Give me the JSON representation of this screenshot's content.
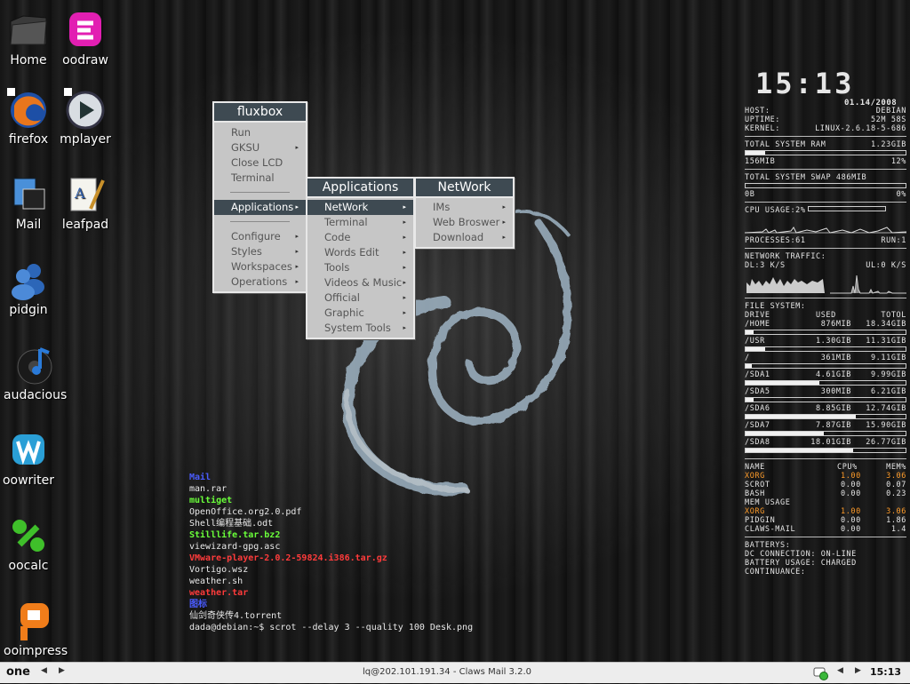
{
  "desktop_icons": [
    {
      "label": "Home",
      "icon": "folder-icon"
    },
    {
      "label": "oodraw",
      "icon": "draw-icon"
    },
    {
      "label": "firefox",
      "icon": "firefox-icon"
    },
    {
      "label": "mplayer",
      "icon": "mplayer-icon"
    },
    {
      "label": "Mail",
      "icon": "mail-icon"
    },
    {
      "label": "leafpad",
      "icon": "leafpad-icon"
    },
    {
      "label": "pidgin",
      "icon": "pidgin-icon"
    },
    {
      "label": "audacious",
      "icon": "audacious-icon"
    },
    {
      "label": "oowriter",
      "icon": "writer-icon"
    },
    {
      "label": "oocalc",
      "icon": "calc-icon"
    },
    {
      "label": "ooimpress",
      "icon": "impress-icon"
    }
  ],
  "root_menu": {
    "title": "fluxbox",
    "items": [
      "Run",
      "GKSU",
      "Close LCD",
      "Terminal",
      "Applications",
      "Configure",
      "Styles",
      "Workspaces",
      "Operations"
    ]
  },
  "apps_menu": {
    "title": "Applications",
    "items": [
      "NetWork",
      "Terminal",
      "Code",
      "Words Edit",
      "Tools",
      "Videos & Music",
      "Official",
      "Graphic",
      "System Tools"
    ]
  },
  "network_menu": {
    "title": "NetWork",
    "items": [
      "IMs",
      "Web Broswer",
      "Download"
    ]
  },
  "terminal": {
    "lines": [
      "Mail",
      "man.rar",
      "multiget",
      "OpenOffice.org2.0.pdf",
      "Shell编程基础.odt",
      "Stilllife.tar.bz2",
      "viewizard-gpg.asc",
      "VMware-player-2.0.2-59824.i386.tar.gz",
      "Vortigo.wsz",
      "weather.sh",
      "weather.tar",
      "图标",
      "仙剑奇侠传4.torrent",
      "dada@debian:~$ scrot --delay 3 --quality 100 Desk.png"
    ]
  },
  "conky": {
    "time": "15:13",
    "date": "01.14/2008",
    "host_label": "HOST:",
    "host": "DEBIAN",
    "uptime_label": "UPTIME:",
    "uptime": "52M 58S",
    "kernel_label": "KERNEL:",
    "kernel": "LINUX-2.6.18-5-686",
    "ram_label": "TOTAL SYSTEM RAM",
    "ram_total": "1.23GIB",
    "ram_used": "156MIB",
    "ram_pct": "12%",
    "ram_fraction": 0.12,
    "swap_label": "TOTAL SYSTEM SWAP 486MIB",
    "swap_used": "0B",
    "swap_pct": "0%",
    "swap_fraction": 0,
    "cpu_label": "CPU USAGE:2%",
    "processes_label": "PROCESSES:61",
    "run_label": "RUN:1",
    "net_label": "NETWORK TRAFFIC:",
    "dl": "DL:3 K/S",
    "ul": "UL:0 K/S",
    "fs_label": "FILE SYSTEM:",
    "fs_headers": [
      "DRIVE",
      "USED",
      "TOTOL"
    ],
    "fs": [
      {
        "drive": "/HOME",
        "used": "876MIB",
        "total": "18.34GIB",
        "fraction": 0.05
      },
      {
        "drive": "/USR",
        "used": "1.30GIB",
        "total": "11.31GIB",
        "fraction": 0.12
      },
      {
        "drive": "/",
        "used": "361MIB",
        "total": "9.11GIB",
        "fraction": 0.04
      },
      {
        "drive": "/SDA1",
        "used": "4.61GIB",
        "total": "9.99GIB",
        "fraction": 0.46
      },
      {
        "drive": "/SDA5",
        "used": "300MIB",
        "total": "6.21GIB",
        "fraction": 0.05
      },
      {
        "drive": "/SDA6",
        "used": "8.85GIB",
        "total": "12.74GIB",
        "fraction": 0.69
      },
      {
        "drive": "/SDA7",
        "used": "7.87GIB",
        "total": "15.90GIB",
        "fraction": 0.49
      },
      {
        "drive": "/SDA8",
        "used": "18.01GIB",
        "total": "26.77GIB",
        "fraction": 0.67
      }
    ],
    "proc_headers": [
      "NAME",
      "CPU%",
      "MEM%"
    ],
    "procs_cpu": [
      {
        "name": "XORG",
        "cpu": "1.00",
        "mem": "3.06",
        "highlight": true
      },
      {
        "name": "SCROT",
        "cpu": "0.00",
        "mem": "0.07",
        "highlight": false
      },
      {
        "name": "BASH",
        "cpu": "0.00",
        "mem": "0.23",
        "highlight": false
      }
    ],
    "mem_usage_label": "MEM USAGE",
    "procs_mem": [
      {
        "name": "XORG",
        "cpu": "1.00",
        "mem": "3.06",
        "highlight": true
      },
      {
        "name": "PIDGIN",
        "cpu": "0.00",
        "mem": "1.86",
        "highlight": false
      },
      {
        "name": "CLAWS-MAIL",
        "cpu": "0.00",
        "mem": "1.4",
        "highlight": false
      }
    ],
    "battery_label": "BATTERYS:",
    "dc": "DC CONNECTION: ON-LINE",
    "batt_usage": "BATTERY USAGE: CHARGED",
    "continuance": "CONTINUANCE:"
  },
  "taskbar": {
    "workspace": "one",
    "task_title": "lq@202.101.191.34 - Claws Mail 3.2.0",
    "clock": "15:13"
  }
}
